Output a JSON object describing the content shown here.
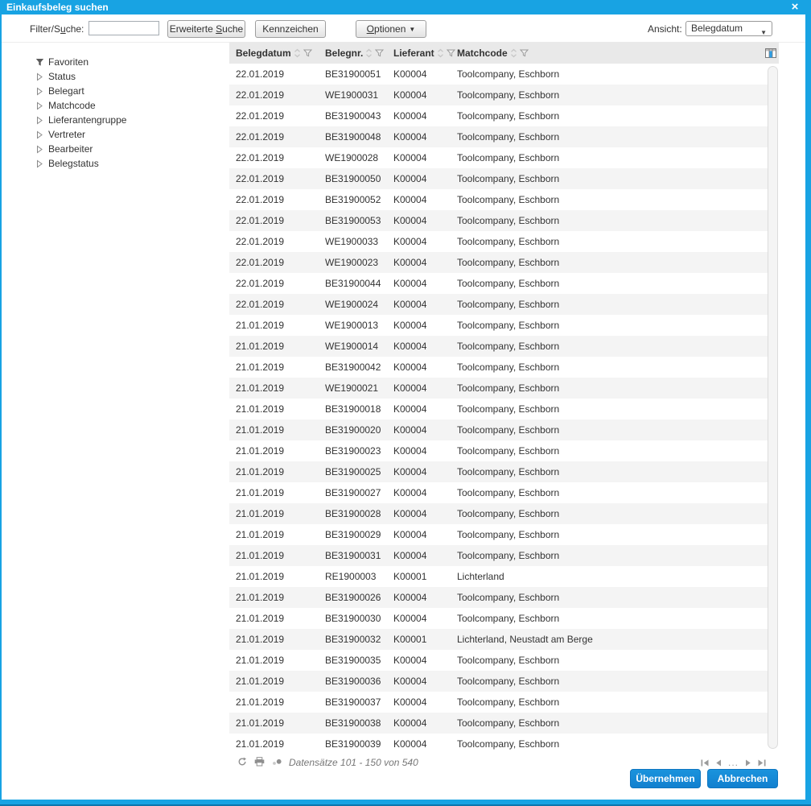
{
  "dialog": {
    "title": "Einkaufsbeleg suchen"
  },
  "icons": {
    "close": "×",
    "dropdown_caret": "▼"
  },
  "toolbar": {
    "filter_label": {
      "pre": "Filter/S",
      "accel": "u",
      "post": "che:"
    },
    "filter_value": "",
    "btn_erweiterte": {
      "pre": "Erweiterte ",
      "accel": "S",
      "post": "uche"
    },
    "btn_kennzeichen": "Kennzeichen",
    "btn_optionen": {
      "pre": "",
      "accel": "O",
      "post": "ptionen"
    },
    "ansicht_label": "Ansicht:",
    "ansicht_value": "Belegdatum"
  },
  "sidebar": {
    "items": [
      {
        "label": "Favoriten",
        "icon": "filter-funnel"
      },
      {
        "label": "Status",
        "icon": "triangle-right"
      },
      {
        "label": "Belegart",
        "icon": "triangle-right"
      },
      {
        "label": "Matchcode",
        "icon": "triangle-right"
      },
      {
        "label": "Lieferantengruppe",
        "icon": "triangle-right"
      },
      {
        "label": "Vertreter",
        "icon": "triangle-right"
      },
      {
        "label": "Bearbeiter",
        "icon": "triangle-right"
      },
      {
        "label": "Belegstatus",
        "icon": "triangle-right"
      }
    ]
  },
  "table": {
    "columns": [
      "Belegdatum",
      "Belegnr.",
      "Lieferant",
      "Matchcode"
    ],
    "rows": [
      [
        "22.01.2019",
        "BE31900051",
        "K00004",
        "Toolcompany, Eschborn"
      ],
      [
        "22.01.2019",
        "WE1900031",
        "K00004",
        "Toolcompany, Eschborn"
      ],
      [
        "22.01.2019",
        "BE31900043",
        "K00004",
        "Toolcompany, Eschborn"
      ],
      [
        "22.01.2019",
        "BE31900048",
        "K00004",
        "Toolcompany, Eschborn"
      ],
      [
        "22.01.2019",
        "WE1900028",
        "K00004",
        "Toolcompany, Eschborn"
      ],
      [
        "22.01.2019",
        "BE31900050",
        "K00004",
        "Toolcompany, Eschborn"
      ],
      [
        "22.01.2019",
        "BE31900052",
        "K00004",
        "Toolcompany, Eschborn"
      ],
      [
        "22.01.2019",
        "BE31900053",
        "K00004",
        "Toolcompany, Eschborn"
      ],
      [
        "22.01.2019",
        "WE1900033",
        "K00004",
        "Toolcompany, Eschborn"
      ],
      [
        "22.01.2019",
        "WE1900023",
        "K00004",
        "Toolcompany, Eschborn"
      ],
      [
        "22.01.2019",
        "BE31900044",
        "K00004",
        "Toolcompany, Eschborn"
      ],
      [
        "22.01.2019",
        "WE1900024",
        "K00004",
        "Toolcompany, Eschborn"
      ],
      [
        "21.01.2019",
        "WE1900013",
        "K00004",
        "Toolcompany, Eschborn"
      ],
      [
        "21.01.2019",
        "WE1900014",
        "K00004",
        "Toolcompany, Eschborn"
      ],
      [
        "21.01.2019",
        "BE31900042",
        "K00004",
        "Toolcompany, Eschborn"
      ],
      [
        "21.01.2019",
        "WE1900021",
        "K00004",
        "Toolcompany, Eschborn"
      ],
      [
        "21.01.2019",
        "BE31900018",
        "K00004",
        "Toolcompany, Eschborn"
      ],
      [
        "21.01.2019",
        "BE31900020",
        "K00004",
        "Toolcompany, Eschborn"
      ],
      [
        "21.01.2019",
        "BE31900023",
        "K00004",
        "Toolcompany, Eschborn"
      ],
      [
        "21.01.2019",
        "BE31900025",
        "K00004",
        "Toolcompany, Eschborn"
      ],
      [
        "21.01.2019",
        "BE31900027",
        "K00004",
        "Toolcompany, Eschborn"
      ],
      [
        "21.01.2019",
        "BE31900028",
        "K00004",
        "Toolcompany, Eschborn"
      ],
      [
        "21.01.2019",
        "BE31900029",
        "K00004",
        "Toolcompany, Eschborn"
      ],
      [
        "21.01.2019",
        "BE31900031",
        "K00004",
        "Toolcompany, Eschborn"
      ],
      [
        "21.01.2019",
        "RE1900003",
        "K00001",
        "Lichterland"
      ],
      [
        "21.01.2019",
        "BE31900026",
        "K00004",
        "Toolcompany, Eschborn"
      ],
      [
        "21.01.2019",
        "BE31900030",
        "K00004",
        "Toolcompany, Eschborn"
      ],
      [
        "21.01.2019",
        "BE31900032",
        "K00001",
        "Lichterland, Neustadt am Berge"
      ],
      [
        "21.01.2019",
        "BE31900035",
        "K00004",
        "Toolcompany, Eschborn"
      ],
      [
        "21.01.2019",
        "BE31900036",
        "K00004",
        "Toolcompany, Eschborn"
      ],
      [
        "21.01.2019",
        "BE31900037",
        "K00004",
        "Toolcompany, Eschborn"
      ],
      [
        "21.01.2019",
        "BE31900038",
        "K00004",
        "Toolcompany, Eschborn"
      ],
      [
        "21.01.2019",
        "BE31900039",
        "K00004",
        "Toolcompany, Eschborn"
      ]
    ]
  },
  "footer": {
    "record_info": "Datensätze 101 - 150 von 540",
    "pager_ellipsis": "..."
  },
  "actions": {
    "apply": "Übernehmen",
    "cancel": "Abbrechen"
  },
  "colors": {
    "accent": "#18a3e3",
    "button_blue": "#1180cf"
  }
}
